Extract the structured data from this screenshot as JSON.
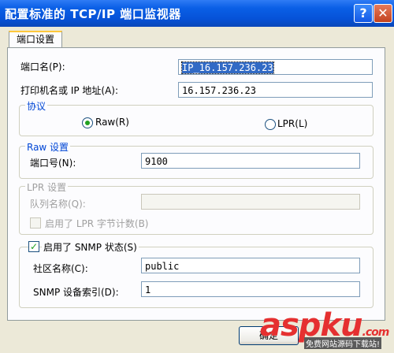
{
  "window": {
    "title": "配置标准的 TCP/IP 端口监视器",
    "help_glyph": "?",
    "close_glyph": "✕"
  },
  "tab": {
    "label": "端口设置"
  },
  "port_name": {
    "label": "端口名(P):",
    "value": "IP_16.157.236.23"
  },
  "host": {
    "label": "打印机名或 IP 地址(A):",
    "value": "16.157.236.23"
  },
  "protocol": {
    "title": "协议",
    "raw_label": "Raw(R)",
    "lpr_label": "LPR(L)",
    "selected": "Raw"
  },
  "raw_settings": {
    "title": "Raw 设置",
    "port_number_label": "端口号(N):",
    "port_number_value": "9100"
  },
  "lpr_settings": {
    "title": "LPR 设置",
    "queue_name_label": "队列名称(Q):",
    "queue_name_value": "",
    "byte_counting_label": "启用了 LPR 字节计数(B)",
    "byte_counting_checked": false
  },
  "snmp": {
    "enabled_label": "启用了 SNMP 状态(S)",
    "enabled_checked": true,
    "community_label": "社区名称(C):",
    "community_value": "public",
    "device_index_label": "SNMP 设备索引(D):",
    "device_index_value": "1"
  },
  "buttons": {
    "ok_label": "确定"
  },
  "watermark": {
    "brand": "aspku",
    "brand_suffix": ".com",
    "tagline": "免费网站源码下载站!"
  }
}
